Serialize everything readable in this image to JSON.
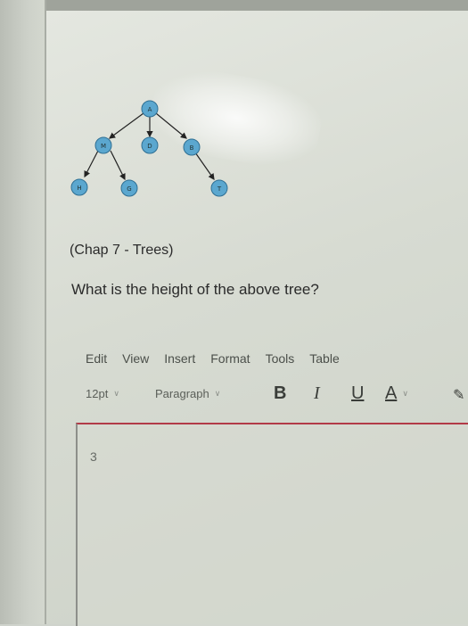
{
  "chapter": "(Chap 7 - Trees)",
  "question": "What is the height of the above tree?",
  "tree": {
    "node_color": "#5ba7cf",
    "nodes": {
      "a": "A",
      "m": "M",
      "d": "D",
      "b": "B",
      "h": "H",
      "g": "G",
      "t": "T"
    }
  },
  "menu": {
    "edit": "Edit",
    "view": "View",
    "insert": "Insert",
    "format": "Format",
    "tools": "Tools",
    "table": "Table"
  },
  "toolbar": {
    "font_size": "12pt",
    "block_format": "Paragraph",
    "bold": "B",
    "italic": "I",
    "underline": "U",
    "text_color": "A"
  },
  "editor": {
    "answer": "3"
  },
  "colors": {
    "accent_border": "#b23a47"
  }
}
